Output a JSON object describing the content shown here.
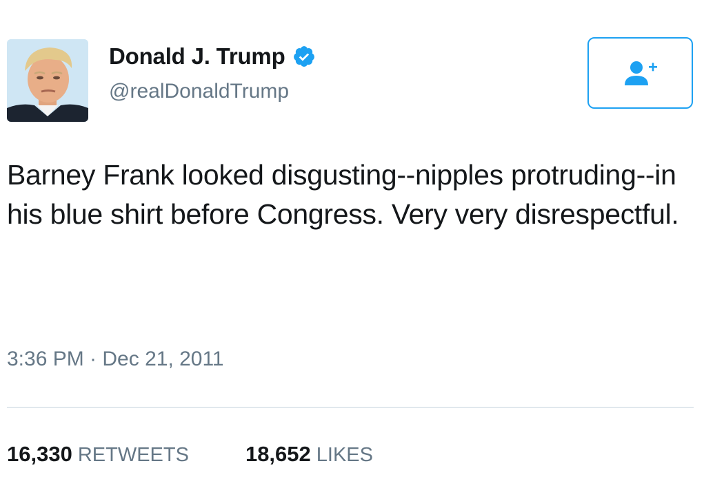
{
  "author": {
    "display_name": "Donald J. Trump",
    "handle": "@realDonaldTrump",
    "verified": true,
    "verified_icon": "verified-badge-icon"
  },
  "follow_button": {
    "icon": "add-user-icon"
  },
  "tweet": {
    "text": "Barney Frank looked disgusting--nipples protruding--in his blue shirt before Congress. Very very disrespectful.",
    "timestamp": "3:36 PM · Dec 21, 2011"
  },
  "stats": {
    "retweets_count": "16,330",
    "retweets_label": "RETWEETS",
    "likes_count": "18,652",
    "likes_label": "LIKES"
  },
  "colors": {
    "accent": "#1da1f2",
    "text_primary": "#14171a",
    "text_secondary": "#657786",
    "divider": "#e1e8ed"
  }
}
